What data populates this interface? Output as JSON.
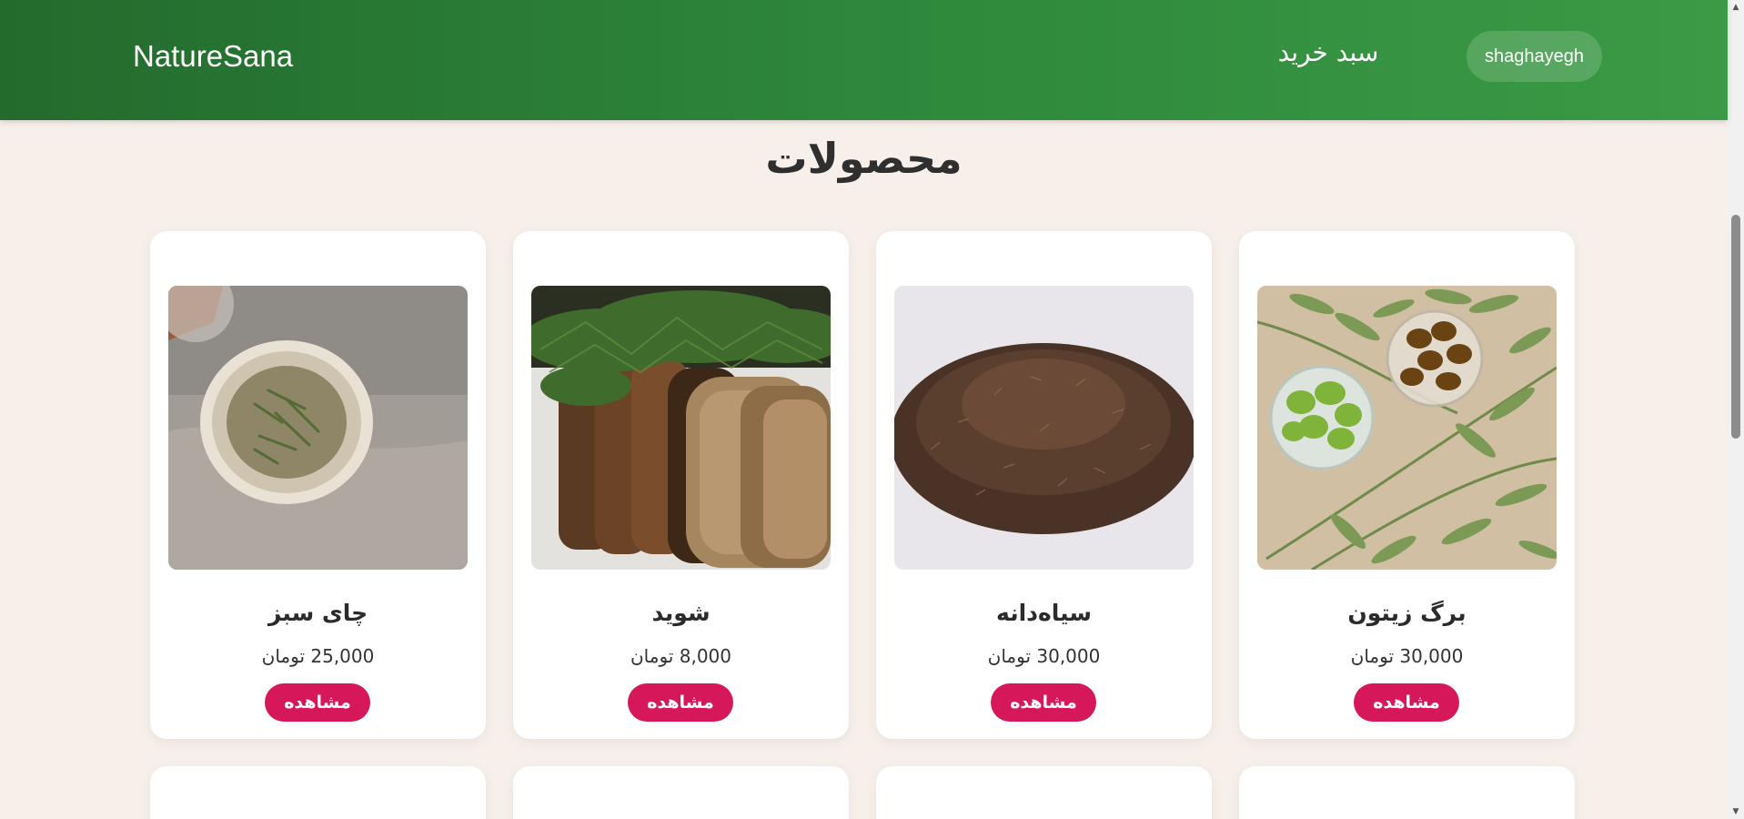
{
  "header": {
    "brand": "NatureSana",
    "cart_label": "سبد خرید",
    "user_label": "shaghayegh"
  },
  "main": {
    "title": "محصولات",
    "products": [
      {
        "name": "برگ زیتون",
        "price": "30,000 تومان",
        "button": "مشاهده",
        "image": "olives-and-olive-leaves"
      },
      {
        "name": "سیاه‌دانه",
        "price": "30,000 تومان",
        "button": "مشاهده",
        "image": "black-cumin-seeds"
      },
      {
        "name": "شوید",
        "price": "8,000 تومان",
        "button": "مشاهده",
        "image": "dill-on-bread"
      },
      {
        "name": "چای سبز",
        "price": "25,000 تومان",
        "button": "مشاهده",
        "image": "green-tea-leaves-in-bowl"
      }
    ]
  },
  "colors": {
    "header_start": "#236b2d",
    "header_end": "#3a9a45",
    "background": "#f6efea",
    "button": "#d6185a"
  }
}
